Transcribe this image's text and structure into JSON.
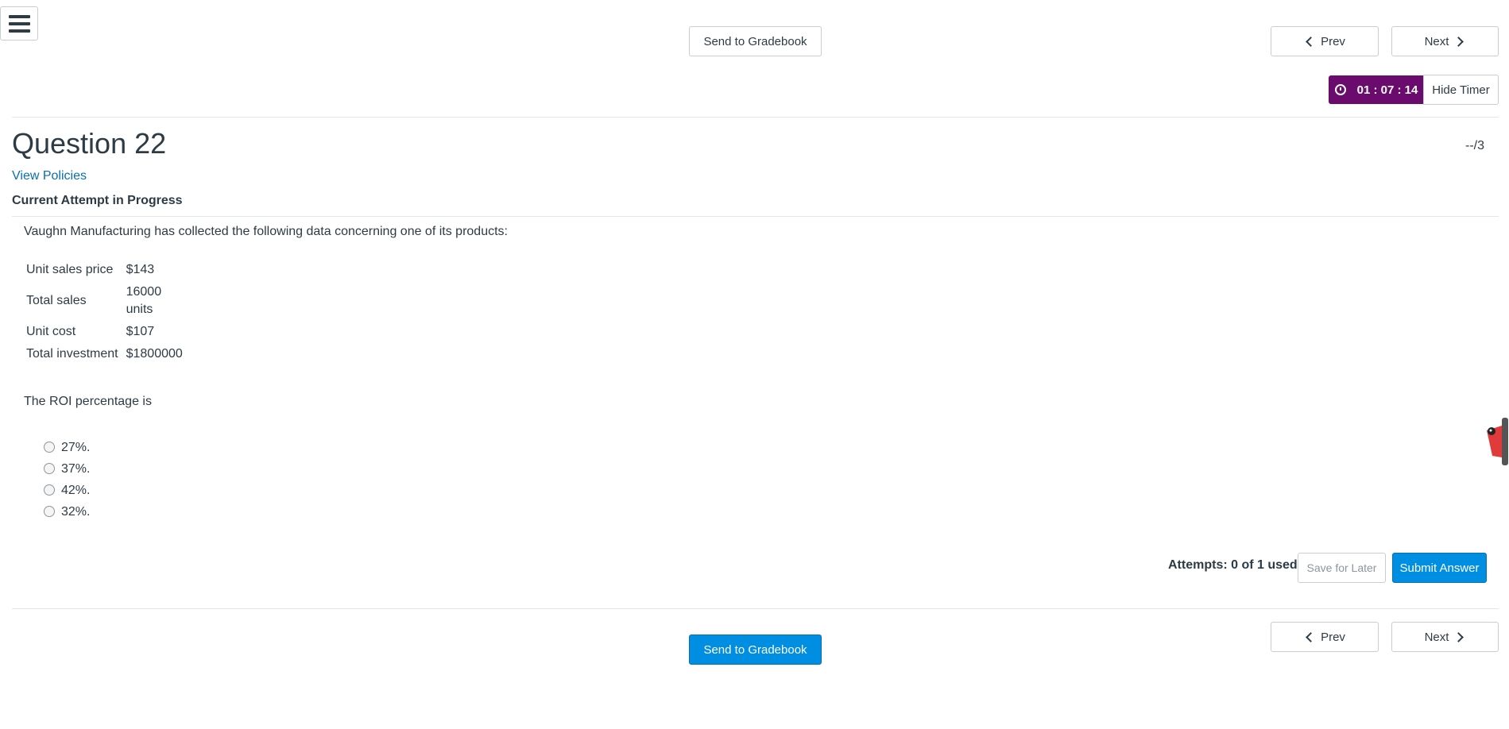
{
  "nav": {
    "send_gradebook_label": "Send to Gradebook",
    "prev_label": "Prev",
    "next_label": "Next"
  },
  "timer": {
    "value": "01 : 07 : 14",
    "hide_label": "Hide Timer",
    "color": "#6b0b6d"
  },
  "question": {
    "title": "Question 22",
    "score": "--/3",
    "view_policies": "View Policies",
    "attempt_status": "Current Attempt in Progress",
    "prompt": "Vaughn Manufacturing has collected the following data concerning one of its products:",
    "data_rows": [
      {
        "label": "Unit sales price",
        "value": "$143"
      },
      {
        "label": "Total sales",
        "value": "16000 units"
      },
      {
        "label": "Unit cost",
        "value": "$107"
      },
      {
        "label": "Total investment",
        "value": "$1800000"
      }
    ],
    "question_text": "The ROI percentage is",
    "options": [
      "27%.",
      "37%.",
      "42%.",
      "32%."
    ]
  },
  "footer": {
    "attempts": "Attempts: 0 of 1 used",
    "save_label": "Save for Later",
    "submit_label": "Submit Answer"
  },
  "colors": {
    "primary": "#008ee2",
    "link": "#0770b0",
    "text": "#2d3b45"
  }
}
